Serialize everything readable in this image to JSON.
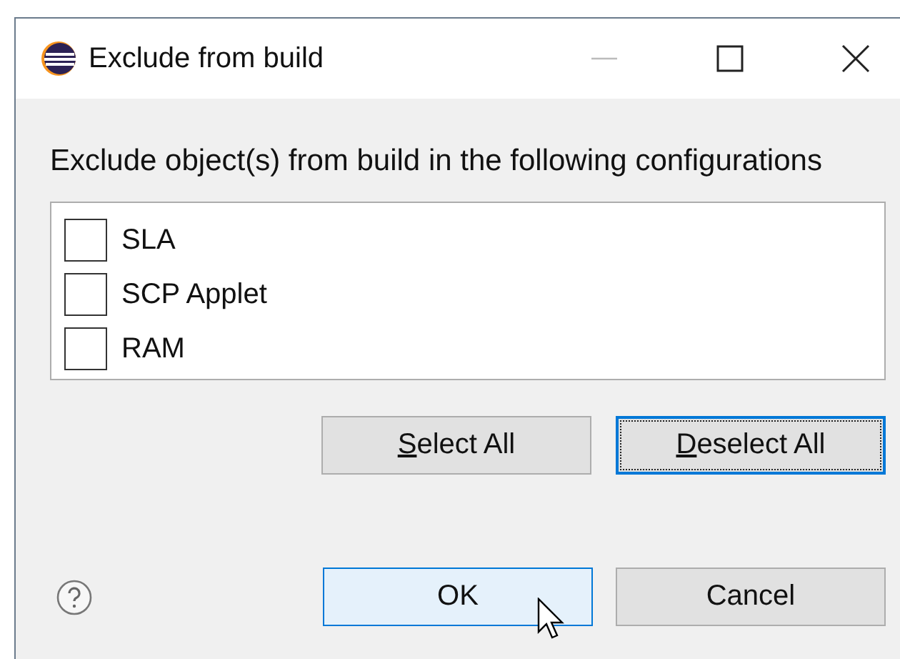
{
  "window": {
    "title": "Exclude from build"
  },
  "instruction": "Exclude object(s) from build in the following configurations",
  "configurations": [
    {
      "label": "SLA",
      "checked": false
    },
    {
      "label": "SCP Applet",
      "checked": false
    },
    {
      "label": "RAM",
      "checked": false
    }
  ],
  "selection_buttons": [
    {
      "label": "Select All",
      "mnemonic_first": true,
      "focused": false
    },
    {
      "label": "Deselect All",
      "mnemonic_first": true,
      "focused": true
    }
  ],
  "dialog_buttons": [
    {
      "label": "OK",
      "hovered": true
    },
    {
      "label": "Cancel",
      "hovered": false
    }
  ]
}
